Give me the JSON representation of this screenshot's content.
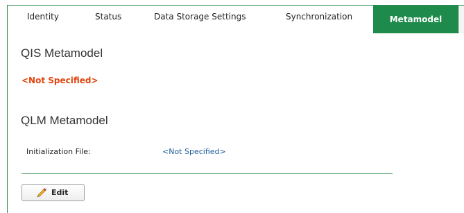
{
  "tabs": [
    {
      "label": "Identity"
    },
    {
      "label": "Status"
    },
    {
      "label": "Data Storage Settings"
    },
    {
      "label": "Synchronization"
    },
    {
      "label": "Metamodel"
    }
  ],
  "active_tab": "Metamodel",
  "qis_section": {
    "title": "QIS Metamodel",
    "value": "<Not Specified>"
  },
  "qlm_section": {
    "title": "QLM Metamodel",
    "field_label": "Initialization File:",
    "field_value": "<Not Specified>"
  },
  "actions": {
    "edit_label": "Edit",
    "edit_icon": "pencil-icon"
  },
  "colors": {
    "accent": "#1e8a4c",
    "warning": "#e2450f",
    "link": "#1e5c9a"
  }
}
